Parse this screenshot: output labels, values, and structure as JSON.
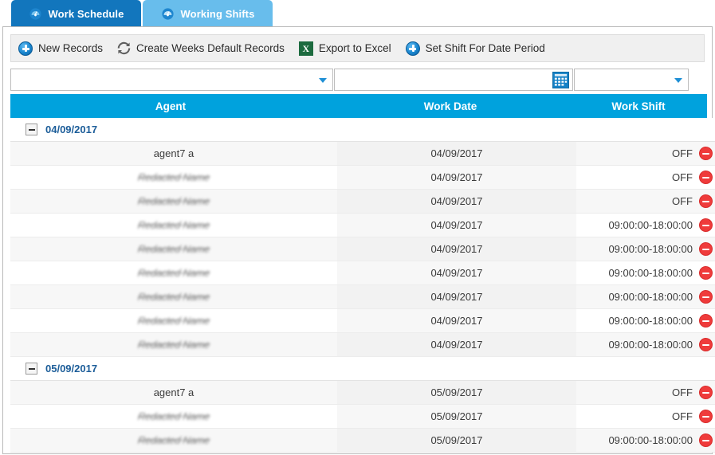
{
  "tabs": [
    {
      "label": "Work Schedule",
      "icon": "dashboard-gauge-icon",
      "active": true
    },
    {
      "label": "Working Shifts",
      "icon": "dashboard-gauge-icon",
      "active": false
    }
  ],
  "toolbar": {
    "new_records_label": "New Records",
    "new_records_icon": "plus-circle-icon",
    "create_weeks_label": "Create Weeks Default Records",
    "create_weeks_icon": "refresh-icon",
    "export_excel_label": "Export to Excel",
    "export_excel_icon": "excel-icon",
    "set_shift_label": "Set Shift For Date Period",
    "set_shift_icon": "plus-circle-icon"
  },
  "filters": {
    "agent": {
      "value": "",
      "placeholder": "",
      "icon": "chevron-down-icon"
    },
    "work_date": {
      "value": "",
      "placeholder": "",
      "icon": "calendar-icon"
    },
    "work_shift": {
      "value": "",
      "placeholder": "",
      "icon": "chevron-down-icon"
    }
  },
  "grid": {
    "columns": [
      {
        "key": "agent",
        "label": "Agent"
      },
      {
        "key": "work_date",
        "label": "Work Date"
      },
      {
        "key": "work_shift",
        "label": "Work Shift"
      }
    ],
    "groups": [
      {
        "label": "04/09/2017",
        "collapse_icon": "minus-square-icon",
        "rows": [
          {
            "agent": "agent7 a",
            "redacted": false,
            "work_date": "04/09/2017",
            "work_shift": "OFF"
          },
          {
            "agent": "Redacted Name",
            "redacted": true,
            "work_date": "04/09/2017",
            "work_shift": "OFF"
          },
          {
            "agent": "Redacted Name",
            "redacted": true,
            "work_date": "04/09/2017",
            "work_shift": "OFF"
          },
          {
            "agent": "Redacted Name",
            "redacted": true,
            "work_date": "04/09/2017",
            "work_shift": "09:00:00-18:00:00"
          },
          {
            "agent": "Redacted Name",
            "redacted": true,
            "work_date": "04/09/2017",
            "work_shift": "09:00:00-18:00:00"
          },
          {
            "agent": "Redacted Name",
            "redacted": true,
            "work_date": "04/09/2017",
            "work_shift": "09:00:00-18:00:00"
          },
          {
            "agent": "Redacted Name",
            "redacted": true,
            "work_date": "04/09/2017",
            "work_shift": "09:00:00-18:00:00"
          },
          {
            "agent": "Redacted Name",
            "redacted": true,
            "work_date": "04/09/2017",
            "work_shift": "09:00:00-18:00:00"
          },
          {
            "agent": "Redacted Name",
            "redacted": true,
            "work_date": "04/09/2017",
            "work_shift": "09:00:00-18:00:00"
          }
        ]
      },
      {
        "label": "05/09/2017",
        "collapse_icon": "minus-square-icon",
        "rows": [
          {
            "agent": "agent7 a",
            "redacted": false,
            "work_date": "05/09/2017",
            "work_shift": "OFF"
          },
          {
            "agent": "Redacted Name",
            "redacted": true,
            "work_date": "05/09/2017",
            "work_shift": "OFF"
          },
          {
            "agent": "Redacted Name",
            "redacted": true,
            "work_date": "05/09/2017",
            "work_shift": "09:00:00-18:00:00"
          }
        ]
      }
    ],
    "row_action_icon": "delete-circle-icon"
  },
  "colors": {
    "tab_active": "#1276bd",
    "tab_inactive": "#68bdec",
    "grid_header": "#00a2dd",
    "group_label": "#1c5d99",
    "delete": "#ef3b3b",
    "excel_green": "#1d6b3f"
  }
}
